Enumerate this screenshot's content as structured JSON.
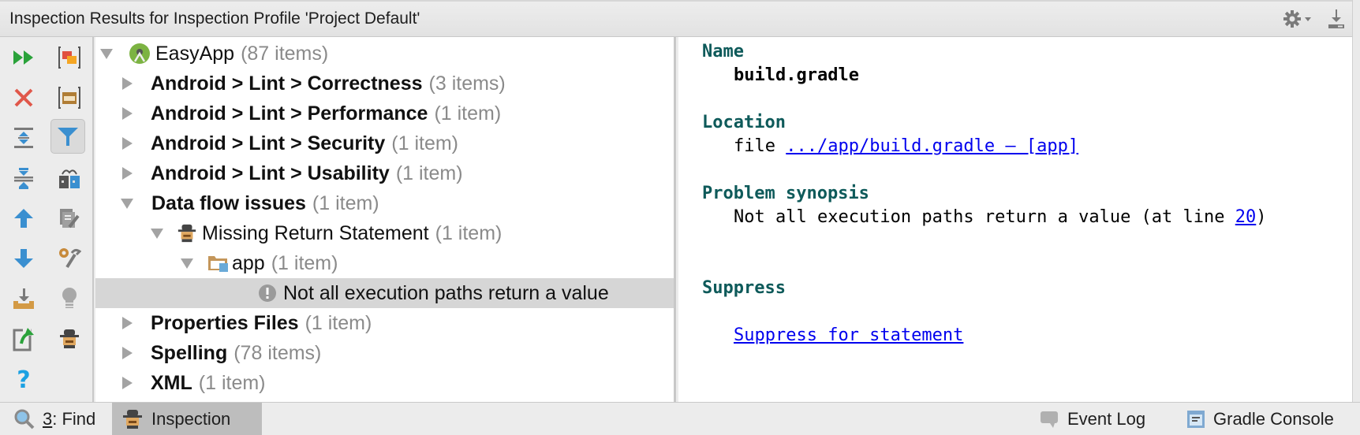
{
  "window": {
    "title": "Inspection Results for Inspection Profile 'Project Default'",
    "header_icons": [
      "gear-dropdown-icon",
      "download-icon"
    ]
  },
  "toolbar": {
    "left_column": [
      {
        "icon": "rerun-icon",
        "tooltip_name": "rerun"
      },
      {
        "icon": "close-icon",
        "tooltip_name": "close"
      },
      {
        "icon": "expand-all-icon",
        "tooltip_name": "expand-all"
      },
      {
        "icon": "collapse-all-icon",
        "tooltip_name": "collapse-all"
      },
      {
        "icon": "arrow-up-icon",
        "tooltip_name": "previous-problem"
      },
      {
        "icon": "arrow-down-icon",
        "tooltip_name": "next-problem"
      },
      {
        "icon": "export-icon",
        "tooltip_name": "export"
      },
      {
        "icon": "open-source-icon",
        "tooltip_name": "open-source"
      },
      {
        "icon": "help-icon",
        "tooltip_name": "help"
      }
    ],
    "right_column": [
      {
        "icon": "group-by-severity-icon",
        "active": false
      },
      {
        "icon": "group-by-directory-icon",
        "active": false
      },
      {
        "icon": "filter-icon",
        "active": true
      },
      {
        "icon": "compare-icon",
        "active": false
      },
      {
        "icon": "edit-settings-icon",
        "active": false
      },
      {
        "icon": "tools-icon",
        "active": false
      },
      {
        "icon": "quick-fix-bulb-icon",
        "active": false
      },
      {
        "icon": "inspector-icon",
        "active": false
      }
    ]
  },
  "tree": {
    "rows": [
      {
        "label": "EasyApp",
        "count": "(87 items)",
        "level": 0,
        "expanded": true,
        "bold": false,
        "icon": "android-module-icon"
      },
      {
        "label": "Android > Lint > Correctness",
        "count": "(3 items)",
        "level": 1,
        "expanded": false,
        "bold": true
      },
      {
        "label": "Android > Lint > Performance",
        "count": "(1 item)",
        "level": 1,
        "expanded": false,
        "bold": true
      },
      {
        "label": "Android > Lint > Security",
        "count": "(1 item)",
        "level": 1,
        "expanded": false,
        "bold": true
      },
      {
        "label": "Android > Lint > Usability",
        "count": "(1 item)",
        "level": 1,
        "expanded": false,
        "bold": true
      },
      {
        "label": "Data flow issues",
        "count": "(1 item)",
        "level": 1,
        "expanded": true,
        "bold": true
      },
      {
        "label": "Missing Return Statement",
        "count": "(1 item)",
        "level": 2,
        "expanded": true,
        "bold": false,
        "icon": "inspector-icon"
      },
      {
        "label": "app",
        "count": "(1 item)",
        "level": 3,
        "expanded": true,
        "bold": false,
        "icon": "module-folder-icon"
      },
      {
        "label": "Not all execution paths return a value",
        "count": "",
        "level": 4,
        "leaf": true,
        "selected": true,
        "icon": "warning-icon"
      },
      {
        "label": "Properties Files",
        "count": "(1 item)",
        "level": 1,
        "expanded": false,
        "bold": true
      },
      {
        "label": "Spelling",
        "count": "(78 items)",
        "level": 1,
        "expanded": false,
        "bold": true
      },
      {
        "label": "XML",
        "count": "(1 item)",
        "level": 1,
        "expanded": false,
        "bold": true
      }
    ]
  },
  "details": {
    "name_heading": "Name",
    "name_value": "build.gradle",
    "location_heading": "Location",
    "location_prefix": "file",
    "location_link": ".../app/build.gradle – [app]",
    "synopsis_heading": "Problem synopsis",
    "synopsis_text": "Not all execution paths return a value (at line ",
    "synopsis_line": "20",
    "synopsis_suffix": ")",
    "suppress_heading": "Suppress",
    "suppress_link": "Suppress for statement"
  },
  "statusbar": {
    "find_number": "3",
    "find_label": ": Find",
    "inspection_label": "Inspection",
    "event_log_label": "Event Log",
    "gradle_console_label": "Gradle Console"
  },
  "colors": {
    "heading": "#0e5a5a",
    "link": "#0000ee",
    "selection": "#d6d6d6",
    "count": "#8a8a8a"
  }
}
